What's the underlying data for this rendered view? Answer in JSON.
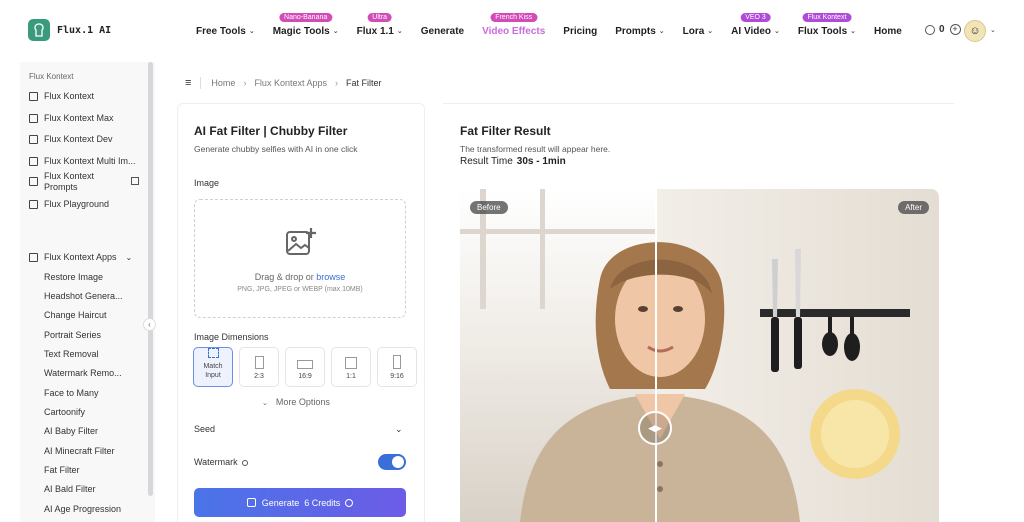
{
  "app": {
    "brand": "Flux.1 AI"
  },
  "nav": {
    "items": [
      {
        "label": "Free Tools",
        "chevron": true,
        "badge": ""
      },
      {
        "label": "Magic Tools",
        "chevron": true,
        "badge": "Nano-Banana"
      },
      {
        "label": "Flux 1.1",
        "chevron": true,
        "badge": "Ultra"
      },
      {
        "label": "Generate",
        "chevron": false,
        "badge": ""
      },
      {
        "label": "Video Effects",
        "chevron": false,
        "badge": "French Kiss",
        "active": true
      },
      {
        "label": "Pricing",
        "chevron": false,
        "badge": ""
      },
      {
        "label": "Prompts",
        "chevron": true,
        "badge": ""
      },
      {
        "label": "Lora",
        "chevron": true,
        "badge": ""
      },
      {
        "label": "AI Video",
        "chevron": true,
        "badge": "VEO 3"
      },
      {
        "label": "Flux Tools",
        "chevron": true,
        "badge": "Flux Kontext"
      },
      {
        "label": "Home",
        "chevron": false,
        "badge": ""
      }
    ],
    "credits": "0"
  },
  "sidebar": {
    "section_title": "Flux Kontext",
    "items": [
      {
        "label": "Flux Kontext",
        "icon": "image-icon"
      },
      {
        "label": "Flux Kontext Max",
        "icon": "sparkle-icon"
      },
      {
        "label": "Flux Kontext Dev",
        "icon": "image-icon"
      },
      {
        "label": "Flux Kontext Multi Im...",
        "icon": "images-icon"
      },
      {
        "label_line1": "Flux Kontext",
        "label_line2": "Prompts",
        "icon": "prompts-icon"
      },
      {
        "label": "Flux Playground",
        "icon": "image-icon"
      }
    ],
    "apps_group": "Flux Kontext Apps",
    "apps": [
      "Restore Image",
      "Headshot Genera...",
      "Change Haircut",
      "Portrait Series",
      "Text Removal",
      "Watermark Remo...",
      "Face to Many",
      "Cartoonify",
      "AI Baby Filter",
      "AI Minecraft Filter",
      "Fat Filter",
      "AI Bald Filter",
      "AI Age Progression"
    ]
  },
  "breadcrumb": {
    "home": "Home",
    "parent": "Flux Kontext Apps",
    "current": "Fat Filter"
  },
  "form": {
    "title": "AI Fat Filter | Chubby Filter",
    "subtitle": "Generate chubby selfies with AI in one click",
    "image_label": "Image",
    "dropzone_text": "Drag & drop or ",
    "dropzone_browse": "browse",
    "dropzone_hint": "PNG, JPG, JPEG or WEBP (max 10MB)",
    "dimensions_label": "Image Dimensions",
    "dimensions": [
      {
        "line1": "Match",
        "line2": "Input",
        "selected": true
      },
      {
        "label": "2:3"
      },
      {
        "label": "16:9"
      },
      {
        "label": "1:1"
      },
      {
        "label": "9:16"
      }
    ],
    "more_options": "More Options",
    "seed_label": "Seed",
    "watermark_label": "Watermark",
    "watermark_on": true,
    "generate_label": "Generate",
    "generate_credits": "6 Credits"
  },
  "result": {
    "title": "Fat Filter Result",
    "subtitle": "The transformed result will appear here.",
    "time_label": "Result Time",
    "time_value": "30s - 1min",
    "before_label": "Before",
    "after_label": "After"
  },
  "colors": {
    "accent": "#3b6fd8",
    "brand": "#3a9a7d",
    "active_nav": "#c86bdc"
  }
}
